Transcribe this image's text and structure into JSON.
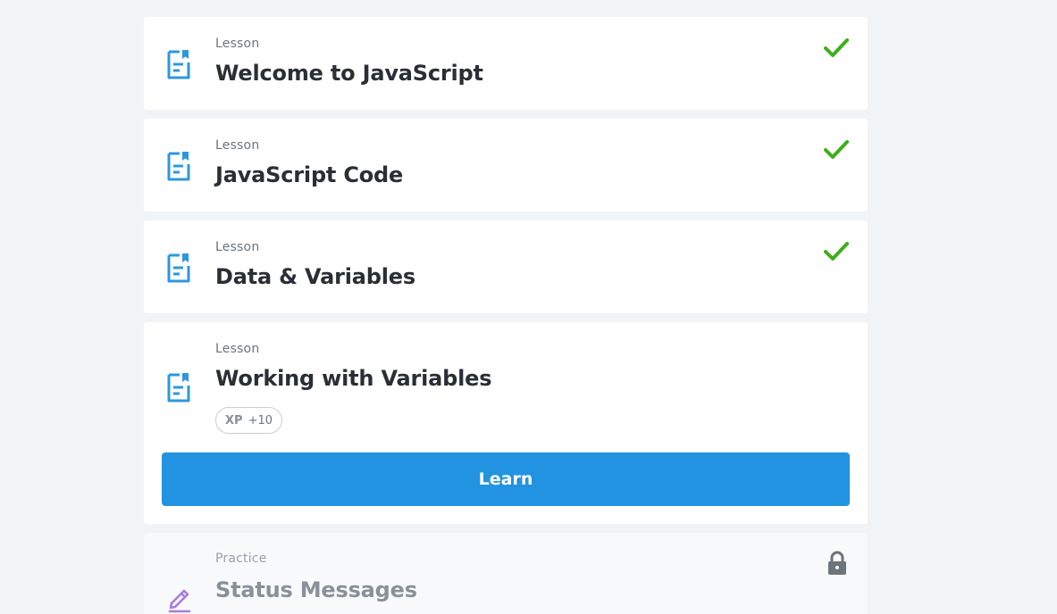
{
  "colors": {
    "page_background": "#f1f4f7",
    "card_background": "#ffffff",
    "accent_blue": "#2293e0",
    "lesson_icon": "#2c98e0",
    "practice_icon": "#a77de0",
    "check_green": "#3fae1a",
    "lock_gray": "#6e747c"
  },
  "items": [
    {
      "type": "Lesson",
      "title": "Welcome to JavaScript",
      "status": "completed",
      "icon": "lesson-document-icon",
      "status_icon": "checkmark-icon"
    },
    {
      "type": "Lesson",
      "title": "JavaScript Code",
      "status": "completed",
      "icon": "lesson-document-icon",
      "status_icon": "checkmark-icon"
    },
    {
      "type": "Lesson",
      "title": "Data & Variables",
      "status": "completed",
      "icon": "lesson-document-icon",
      "status_icon": "checkmark-icon"
    },
    {
      "type": "Lesson",
      "title": "Working with Variables",
      "status": "current",
      "icon": "lesson-document-icon",
      "xp_label": "XP",
      "xp_value": "+10",
      "button_label": "Learn"
    },
    {
      "type": "Practice",
      "title": "Status Messages",
      "status": "locked",
      "icon": "practice-pencil-icon",
      "status_icon": "lock-icon"
    }
  ]
}
